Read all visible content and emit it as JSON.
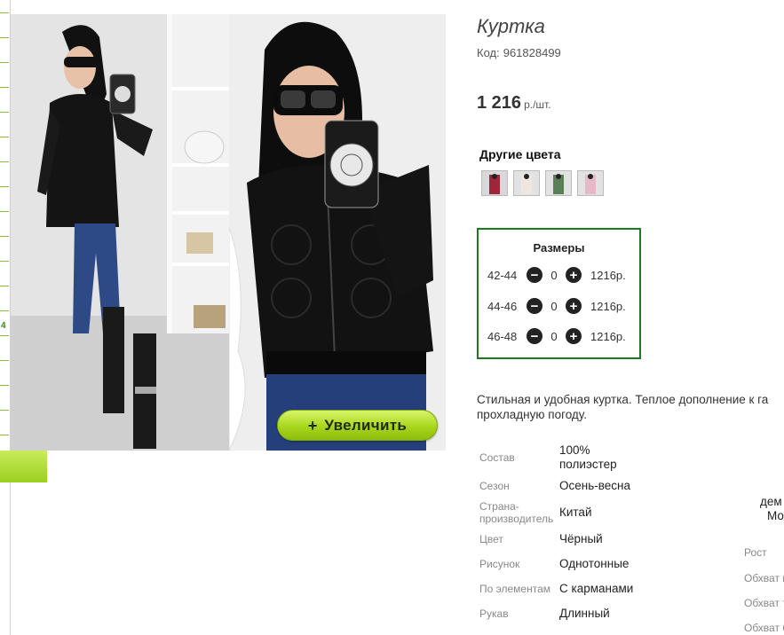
{
  "sidebar": {
    "ruler_number": "4"
  },
  "gallery": {
    "zoom_label": "Увеличить",
    "zoom_icon": "plus-icon"
  },
  "product": {
    "title": "Куртка",
    "code_label": "Код:",
    "code_value": "961828499",
    "price": "1 216",
    "price_unit": "р./шт."
  },
  "other_colors": {
    "title": "Другие цвета",
    "swatch_colors": [
      "#a0243a",
      "#e6d7d2",
      "#5b7f57",
      "#e7b9c8"
    ]
  },
  "sizes": {
    "title": "Размеры",
    "rows": [
      {
        "size": "42-44",
        "qty": "0",
        "price": "1216р."
      },
      {
        "size": "44-46",
        "qty": "0",
        "price": "1216р."
      },
      {
        "size": "46-48",
        "qty": "0",
        "price": "1216р."
      }
    ]
  },
  "description": {
    "line1": "Стильная и удобная куртка. Теплое дополнение к га",
    "line2": "прохладную погоду."
  },
  "specs": [
    {
      "label": "Состав",
      "value": "100%\nполиэстер"
    },
    {
      "label": "Сезон",
      "value": "Осень-весна"
    },
    {
      "label": "Страна-\nпроизводитель",
      "value": "Китай"
    },
    {
      "label": "Цвет",
      "value": "Чёрный"
    },
    {
      "label": "Рисунок",
      "value": "Однотонные"
    },
    {
      "label": "По элементам",
      "value": "С карманами"
    },
    {
      "label": "Рукав",
      "value": "Длинный"
    }
  ],
  "model_params": {
    "line1": "дем",
    "line2": "Мо",
    "rows": [
      "Рост",
      "Обхват г",
      "Обхват т",
      "Обхват б"
    ]
  },
  "colors": {
    "accent_green": "#1f7a1f",
    "button_green": "#a8d61c"
  }
}
